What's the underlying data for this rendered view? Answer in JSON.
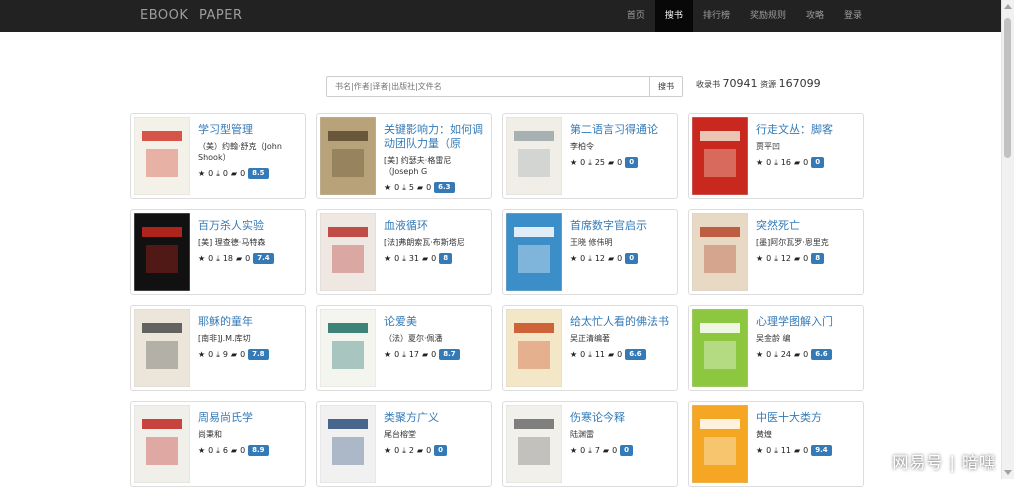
{
  "brand": "EBOOK   PAPER",
  "nav": [
    {
      "label": "首页",
      "active": false
    },
    {
      "label": "搜书",
      "active": true
    },
    {
      "label": "排行榜",
      "active": false
    },
    {
      "label": "奖励规则",
      "active": false
    },
    {
      "label": "攻略",
      "active": false
    },
    {
      "label": "登录",
      "active": false
    }
  ],
  "search": {
    "placeholder": "书名|作者|译者|出版社|文件名",
    "button": "搜书"
  },
  "stats": {
    "collected_label": "收录书",
    "collected": "70941",
    "resources_label": "资源",
    "resources": "167099"
  },
  "books": [
    {
      "title": "学习型管理",
      "author": "（美）约翰·舒克（John Shook）",
      "stars": "0",
      "downloads": "0",
      "comments": "0",
      "score": "8.5",
      "cover_bg": "#f4f1e8",
      "cover_accent": "#d03a2c"
    },
    {
      "title": "关键影响力：如何调动团队力量（原",
      "author": "[美] 约瑟夫·格雷尼（Joseph G",
      "stars": "0",
      "downloads": "5",
      "comments": "0",
      "score": "6.3",
      "cover_bg": "#b8a27a",
      "cover_accent": "#5b4a2e"
    },
    {
      "title": "第二语言习得通论",
      "author": "李柏令",
      "stars": "0",
      "downloads": "25",
      "comments": "0",
      "score": "0",
      "cover_bg": "#f0eee6",
      "cover_accent": "#9aa6a8"
    },
    {
      "title": "行走文丛：脚客",
      "author": "贾平凹",
      "stars": "0",
      "downloads": "16",
      "comments": "0",
      "score": "0",
      "cover_bg": "#c9281f",
      "cover_accent": "#f2e2d0"
    },
    {
      "title": "百万杀人实验",
      "author": "[美] 理查德·马特森",
      "stars": "0",
      "downloads": "18",
      "comments": "0",
      "score": "7.4",
      "cover_bg": "#111111",
      "cover_accent": "#c8281e"
    },
    {
      "title": "血液循环",
      "author": "[法]弗朗索瓦·布斯塔尼",
      "stars": "0",
      "downloads": "31",
      "comments": "0",
      "score": "8",
      "cover_bg": "#efe7e2",
      "cover_accent": "#b8312c"
    },
    {
      "title": "首席数字官启示",
      "author": "王晓 修伟明",
      "stars": "0",
      "downloads": "12",
      "comments": "0",
      "score": "0",
      "cover_bg": "#3b8ec8",
      "cover_accent": "#ffffff"
    },
    {
      "title": "突然死亡",
      "author": "[墨]阿尔瓦罗·恩里克",
      "stars": "0",
      "downloads": "12",
      "comments": "0",
      "score": "8",
      "cover_bg": "#e8d9c4",
      "cover_accent": "#b5462a"
    },
    {
      "title": "耶稣的童年",
      "author": "[南非]J.M.库切",
      "stars": "0",
      "downloads": "9",
      "comments": "0",
      "score": "7.8",
      "cover_bg": "#ece6da",
      "cover_accent": "#4a4a4a"
    },
    {
      "title": "论爱美",
      "author": "（法）夏尔·佩潘",
      "stars": "0",
      "downloads": "17",
      "comments": "0",
      "score": "8.7",
      "cover_bg": "#f5f5f0",
      "cover_accent": "#1d6e63"
    },
    {
      "title": "给太忙人看的佛法书",
      "author": "吴正清编著",
      "stars": "0",
      "downloads": "11",
      "comments": "0",
      "score": "6.6",
      "cover_bg": "#f3e7c8",
      "cover_accent": "#c84b1f"
    },
    {
      "title": "心理学图解入门",
      "author": "吴金龄 编",
      "stars": "0",
      "downloads": "24",
      "comments": "0",
      "score": "6.6",
      "cover_bg": "#8dc63f",
      "cover_accent": "#ffffff"
    },
    {
      "title": "周易尚氏学",
      "author": "尚秉和",
      "stars": "0",
      "downloads": "6",
      "comments": "0",
      "score": "8.9",
      "cover_bg": "#f1efe9",
      "cover_accent": "#c0251f"
    },
    {
      "title": "类聚方广义",
      "author": "尾台榕堂",
      "stars": "0",
      "downloads": "2",
      "comments": "0",
      "score": "0",
      "cover_bg": "#f1f1f1",
      "cover_accent": "#2a4c7a"
    },
    {
      "title": "伤寒论今释",
      "author": "陆渊雷",
      "stars": "0",
      "downloads": "7",
      "comments": "0",
      "score": "0",
      "cover_bg": "#f2f0ea",
      "cover_accent": "#6b6b6b"
    },
    {
      "title": "中医十大类方",
      "author": "黄煌",
      "stars": "0",
      "downloads": "11",
      "comments": "0",
      "score": "9.4",
      "cover_bg": "#f5a623",
      "cover_accent": "#ffffff"
    }
  ],
  "watermark": "网易号 | 暗嘿"
}
